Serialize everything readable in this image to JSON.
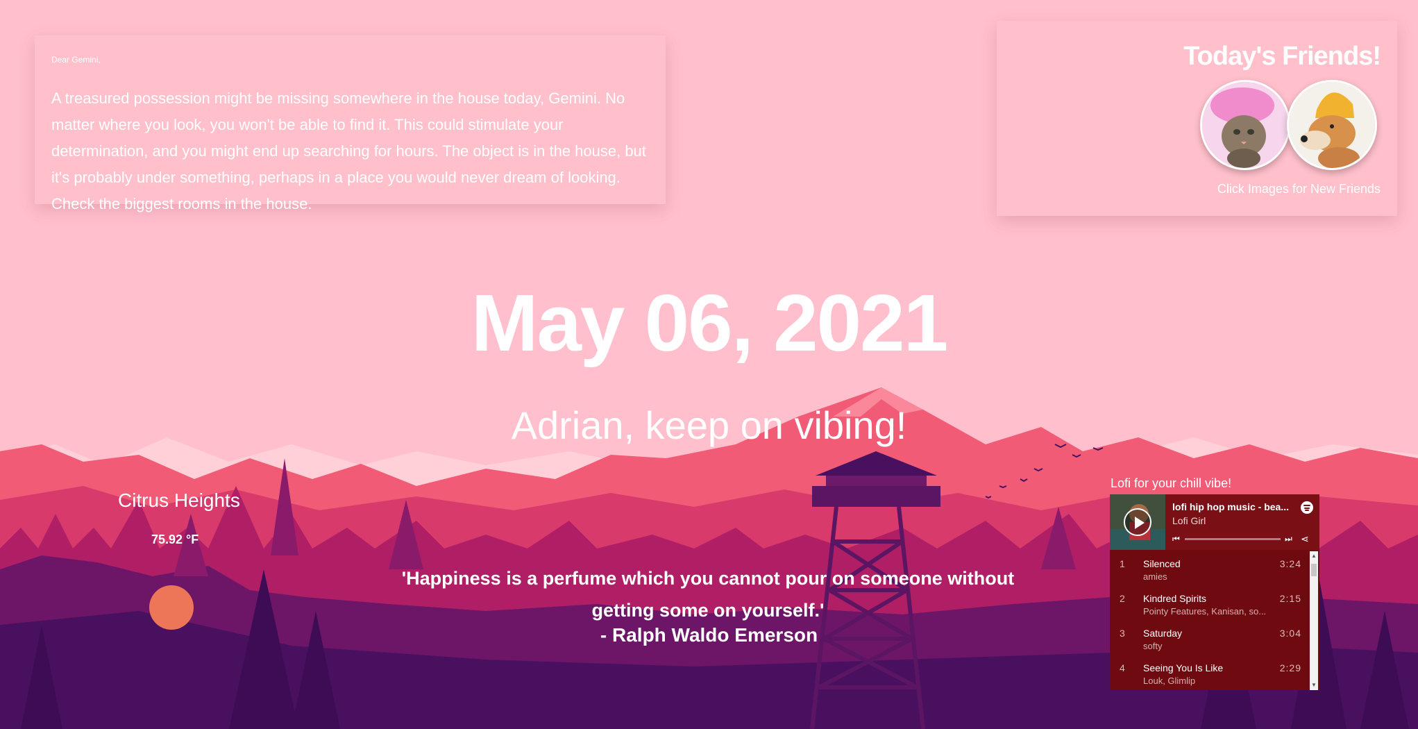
{
  "horoscope": {
    "greeting": "Dear Gemini,",
    "text": "A treasured possession might be missing somewhere in the house today, Gemini. No matter where you look, you won't be able to find it. This could stimulate your determination, and you might end up searching for hours. The object is in the house, but it's probably under something, perhaps in a place you would never dream of looking. Check the biggest rooms in the house."
  },
  "friends": {
    "title": "Today's Friends!",
    "caption": "Click Images for New Friends"
  },
  "date": "May 06, 2021",
  "greeting": "Adrian, keep on vibing!",
  "weather": {
    "city": "Citrus Heights",
    "temp": "75.92 °F"
  },
  "quote": {
    "text": "'Happiness is a perfume which you cannot pour on someone without getting some on yourself.'",
    "author": "- Ralph Waldo Emerson"
  },
  "player": {
    "label": "Lofi for your chill vibe!",
    "title": "lofi hip hop music - bea...",
    "artist": "Lofi Girl",
    "tracks": [
      {
        "num": "1",
        "name": "Silenced",
        "artist": "amies",
        "duration": "3:24"
      },
      {
        "num": "2",
        "name": "Kindred Spirits",
        "artist": "Pointy Features, Kanisan, so...",
        "duration": "2:15"
      },
      {
        "num": "3",
        "name": "Saturday",
        "artist": "softy",
        "duration": "3:04"
      },
      {
        "num": "4",
        "name": "Seeing You Is Like",
        "artist": "Louk, Glimlip",
        "duration": "2:29"
      }
    ]
  },
  "colors": {
    "sky": "#ffbfcc",
    "mountain": "#f0607a",
    "forest": "#b5206a",
    "foreground": "#4a1060",
    "sun": "#ee7658"
  },
  "icons": [
    "play-icon",
    "spotify-icon",
    "previous-icon",
    "next-icon",
    "share-icon",
    "scroll-up-icon",
    "scroll-down-icon"
  ]
}
